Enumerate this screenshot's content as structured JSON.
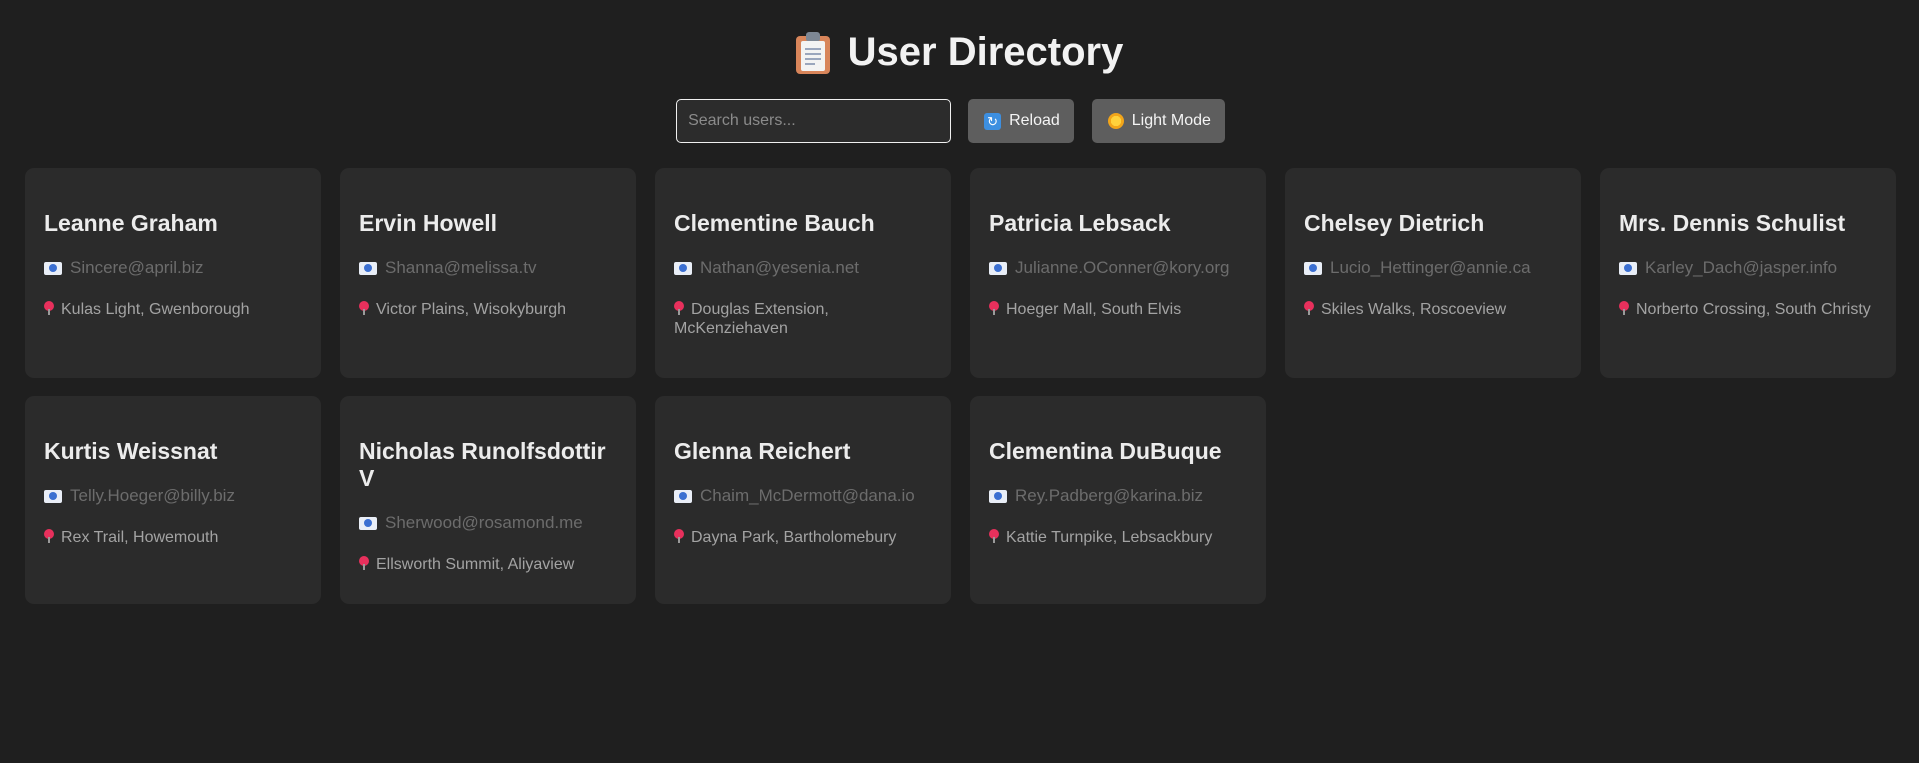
{
  "header": {
    "title": "User Directory",
    "icon": "clipboard-icon"
  },
  "toolbar": {
    "search_placeholder": "Search users...",
    "search_value": "",
    "reload_label": "Reload",
    "reload_icon": "reload-icon",
    "theme_label": "Light Mode",
    "theme_icon": "sun-icon"
  },
  "colors": {
    "background": "#1f1f1f",
    "card": "#2b2b2b",
    "button": "#5e5e5e",
    "email_text": "#6c6c6c",
    "address_text": "#a3a3a3"
  },
  "users": [
    {
      "name": "Leanne Graham",
      "email": "Sincere@april.biz",
      "address": "Kulas Light, Gwenborough"
    },
    {
      "name": "Ervin Howell",
      "email": "Shanna@melissa.tv",
      "address": "Victor Plains, Wisokyburgh"
    },
    {
      "name": "Clementine Bauch",
      "email": "Nathan@yesenia.net",
      "address": "Douglas Extension, McKenziehaven"
    },
    {
      "name": "Patricia Lebsack",
      "email": "Julianne.OConner@kory.org",
      "address": "Hoeger Mall, South Elvis"
    },
    {
      "name": "Chelsey Dietrich",
      "email": "Lucio_Hettinger@annie.ca",
      "address": "Skiles Walks, Roscoeview"
    },
    {
      "name": "Mrs. Dennis Schulist",
      "email": "Karley_Dach@jasper.info",
      "address": "Norberto Crossing, South Christy"
    },
    {
      "name": "Kurtis Weissnat",
      "email": "Telly.Hoeger@billy.biz",
      "address": "Rex Trail, Howemouth"
    },
    {
      "name": "Nicholas Runolfsdottir V",
      "email": "Sherwood@rosamond.me",
      "address": "Ellsworth Summit, Aliyaview"
    },
    {
      "name": "Glenna Reichert",
      "email": "Chaim_McDermott@dana.io",
      "address": "Dayna Park, Bartholomebury"
    },
    {
      "name": "Clementina DuBuque",
      "email": "Rey.Padberg@karina.biz",
      "address": "Kattie Turnpike, Lebsackbury"
    }
  ]
}
